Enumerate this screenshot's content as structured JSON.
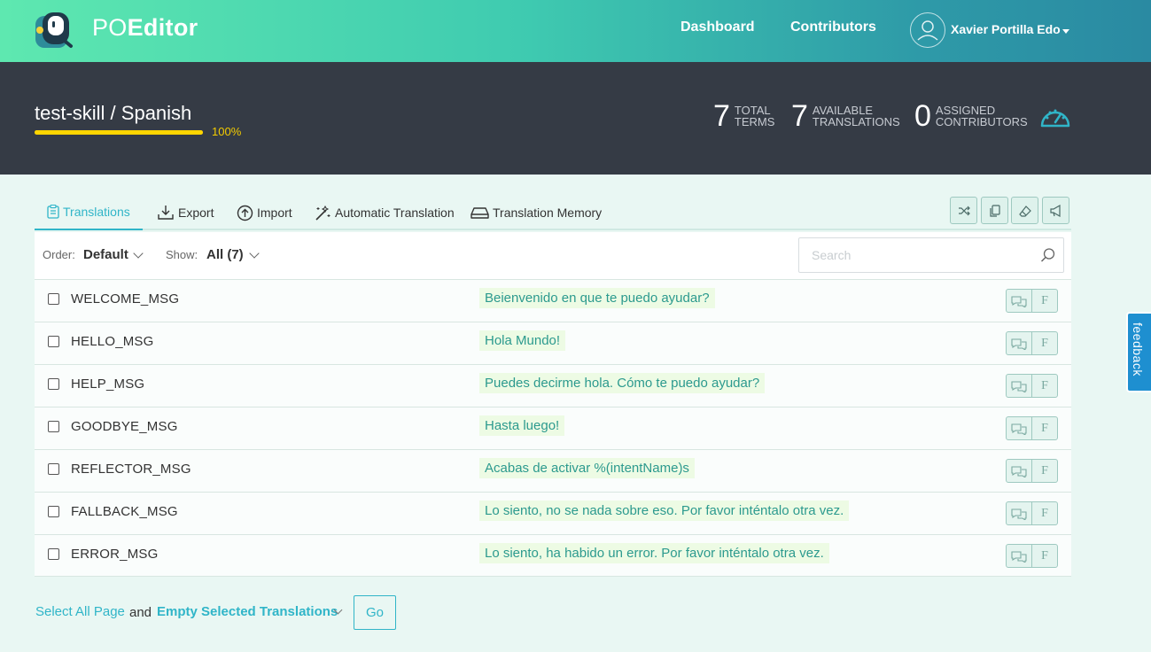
{
  "header": {
    "logo_prefix": "PO",
    "logo_suffix": "Editor",
    "nav": {
      "dashboard": "Dashboard",
      "contributors": "Contributors"
    },
    "user_name": "Xavier Portilla Edo",
    "avatar_icon": "user-avatar-icon"
  },
  "project": {
    "title": "test-skill  / Spanish",
    "progress_value": 100,
    "progress_label": "100%",
    "stats": [
      {
        "number": "7",
        "line1": "TOTAL",
        "line2": "TERMS"
      },
      {
        "number": "7",
        "line1": "AVAILABLE",
        "line2": "TRANSLATIONS"
      },
      {
        "number": "0",
        "line1": "ASSIGNED",
        "line2": "CONTRIBUTORS"
      }
    ],
    "gauge_icon": "dashboard-gauge-icon"
  },
  "tabs": [
    {
      "label": "Translations",
      "icon": "clipboard-icon",
      "active": true
    },
    {
      "label": "Export",
      "icon": "download-icon"
    },
    {
      "label": "Import",
      "icon": "upload-circle-icon"
    },
    {
      "label": "Automatic Translation",
      "icon": "magic-wand-icon"
    },
    {
      "label": "Translation Memory",
      "icon": "drive-icon"
    }
  ],
  "toolbar_icons": [
    "shuffle-icon",
    "copy-icon",
    "eraser-icon",
    "megaphone-icon"
  ],
  "filter": {
    "order_label": "Order:",
    "order_value": "Default",
    "show_label": "Show:",
    "show_value": "All (7)",
    "search_placeholder": "Search"
  },
  "rows": [
    {
      "term": "WELCOME_MSG",
      "translation": "Beienvenido en que te puedo ayudar?"
    },
    {
      "term": "HELLO_MSG",
      "translation": "Hola Mundo!"
    },
    {
      "term": "HELP_MSG",
      "translation": "Puedes decirme hola. Cómo te puedo ayudar?"
    },
    {
      "term": "GOODBYE_MSG",
      "translation": "Hasta luego!"
    },
    {
      "term": "REFLECTOR_MSG",
      "translation": "Acabas de activar %(intentName)s"
    },
    {
      "term": "FALLBACK_MSG",
      "translation": "Lo siento, no se nada sobre eso. Por favor inténtalo otra vez."
    },
    {
      "term": "ERROR_MSG",
      "translation": "Lo siento, ha habido un error. Por favor inténtalo otra vez."
    }
  ],
  "row_buttons": {
    "comment_icon": "comments-icon",
    "fuzzy_label": "F"
  },
  "footer": {
    "select_all": "Select All Page",
    "and": "and",
    "action": "Empty Selected Translations",
    "go": "Go"
  },
  "feedback_label": "feedback"
}
